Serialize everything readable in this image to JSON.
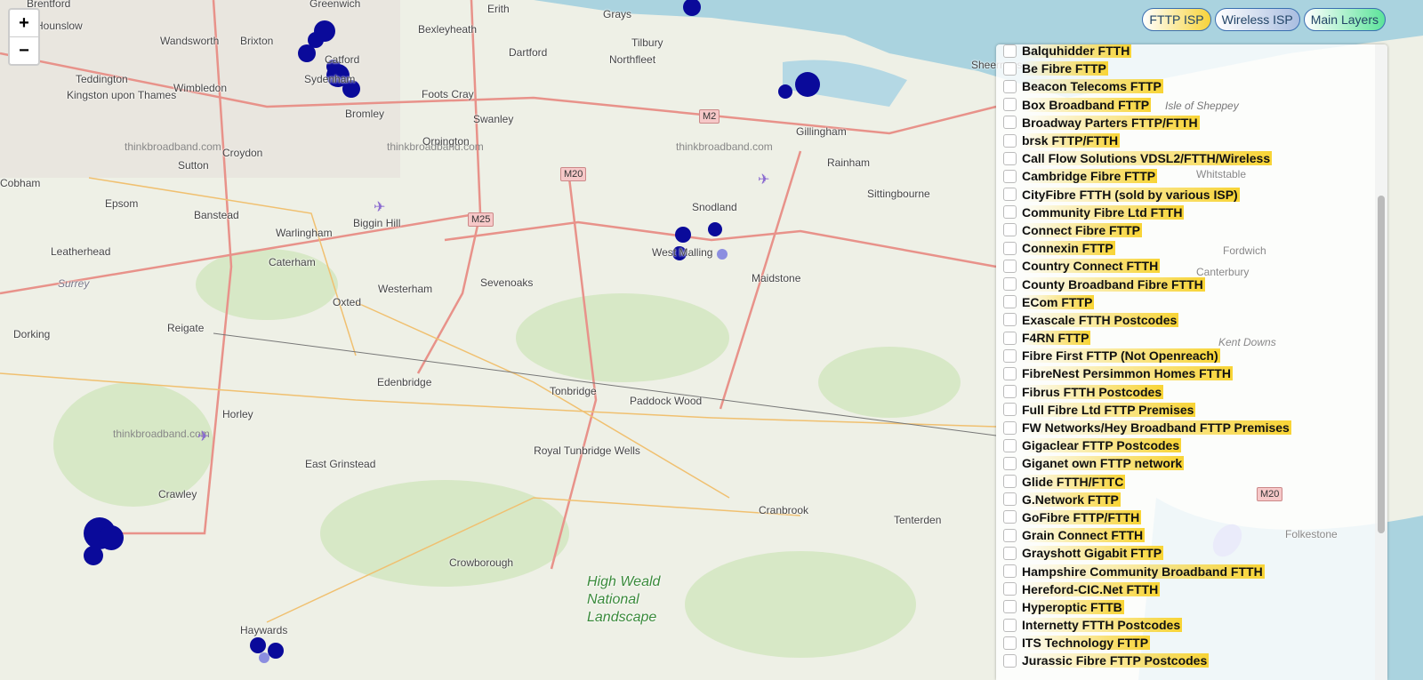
{
  "zoom": {
    "in": "+",
    "out": "−"
  },
  "tabs": [
    "FTTP ISP",
    "Wireless ISP",
    "Main Layers"
  ],
  "colors": {
    "coverage": "#0a0a9a",
    "coverage_faded": "#8c8ee0",
    "sea": "#aad3df",
    "highlight": "#f8d435"
  },
  "places": [
    "Brentford",
    "Greenwich",
    "Erith",
    "Grays",
    "Hounslow",
    "Wandsworth",
    "Brixton",
    "Bexleyheath",
    "Tilbury",
    "Teddington",
    "Kingston upon Thames",
    "Wimbledon",
    "Dartford",
    "Northfleet",
    "Sheerness",
    "Foots Cray",
    "Catford",
    "Sydenham",
    "Bromley",
    "Swanley",
    "Gillingham",
    "Orpington",
    "Croydon",
    "Sutton",
    "Rainham",
    "Epsom",
    "Banstead",
    "Sittingbourne",
    "Cobham",
    "Biggin Hill",
    "Snodland",
    "Warlingham",
    "Leatherhead",
    "Caterham",
    "West Malling",
    "Maidstone",
    "Canterbury",
    "Westerham",
    "Sevenoaks",
    "Oxted",
    "Surrey",
    "Fordwich",
    "Dorking",
    "Reigate",
    "Edenbridge",
    "Tonbridge",
    "Paddock Wood",
    "Horley",
    "East Grinstead",
    "Royal Tunbridge Wells",
    "Crawley",
    "Cranbrook",
    "Tenterden",
    "Crowborough",
    "Folkestone",
    "Haywards",
    "High Weald National Landscape",
    "Kent Downs",
    "Isle of Sheppey",
    "Whitstable"
  ],
  "watermark": "thinkbroadband.com",
  "roads": [
    "M2",
    "M20",
    "M25",
    "M20"
  ],
  "layers": [
    "Balquhidder FTTH",
    "Be Fibre FTTP",
    "Beacon Telecoms FTTP",
    "Box Broadband FTTP",
    "Broadway Parters FTTP/FTTH",
    "brsk FTTP/FTTH",
    "Call Flow Solutions VDSL2/FTTH/Wireless",
    "Cambridge Fibre FTTP",
    "CityFibre FTTH (sold by various ISP)",
    "Community Fibre Ltd FTTH",
    "Connect Fibre FTTP",
    "Connexin FTTP",
    "Country Connect FTTH",
    "County Broadband Fibre FTTH",
    "ECom FTTP",
    "Exascale FTTH Postcodes",
    "F4RN FTTP",
    "Fibre First FTTP (Not Openreach)",
    "FibreNest Persimmon Homes FTTH",
    "Fibrus FTTH Postcodes",
    "Full Fibre Ltd FTTP Premises",
    "FW Networks/Hey Broadband FTTP Premises",
    "Gigaclear FTTP Postcodes",
    "Giganet own FTTP network",
    "Glide FTTH/FTTC",
    "G.Network FTTP",
    "GoFibre FTTP/FTTH",
    "Grain Connect FTTH",
    "Grayshott Gigabit FTTP",
    "Hampshire Community Broadband FTTH",
    "Hereford-CIC.Net FTTH",
    "Hyperoptic FTTB",
    "Internetty FTTH Postcodes",
    "ITS Technology FTTP",
    "Jurassic Fibre FTTP Postcodes"
  ]
}
